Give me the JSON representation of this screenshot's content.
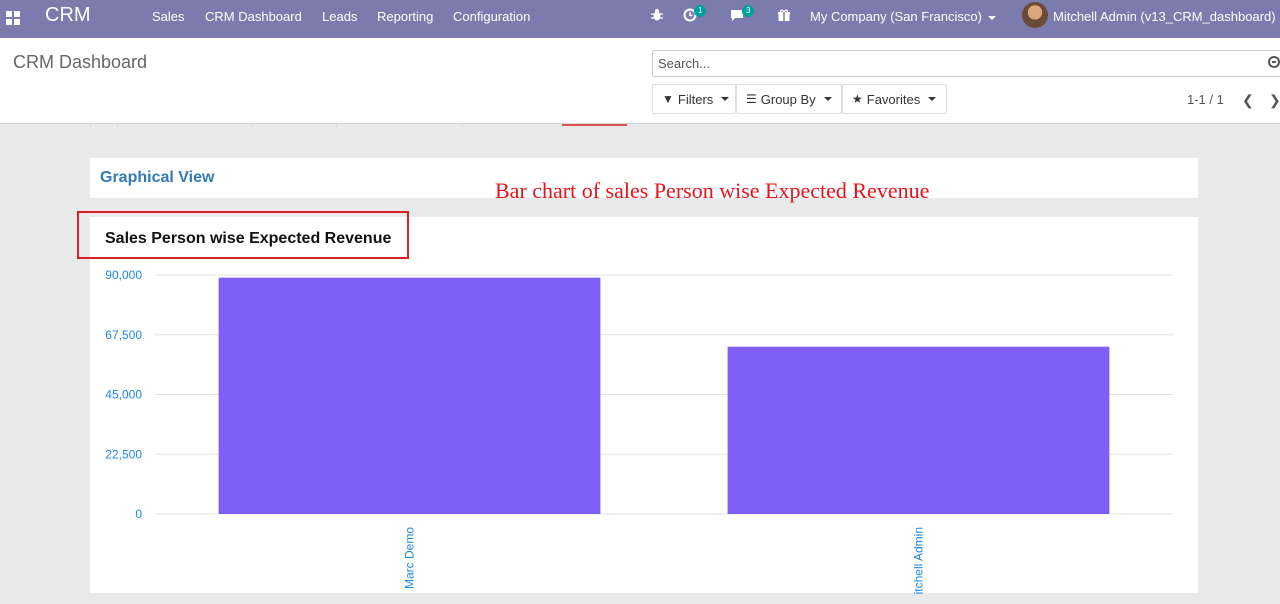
{
  "navbar": {
    "brand": "CRM",
    "menu": [
      "Sales",
      "CRM Dashboard",
      "Leads",
      "Reporting",
      "Configuration"
    ],
    "activity_count": "1",
    "message_count": "3",
    "company": "My Company (San Francisco)",
    "user": "Mitchell Admin (v13_CRM_dashboard)"
  },
  "control_panel": {
    "title": "CRM Dashboard",
    "search_placeholder": "Search...",
    "filters_label": "Filters",
    "group_by_label": "Group By",
    "favorites_label": "Favorites",
    "pager": "1-1 / 1"
  },
  "dashboard": {
    "graphical_view_title": "Graphical View",
    "annotation": "Bar chart of sales Person wise Expected Revenue"
  },
  "colors": {
    "navbar": "#7c7bad",
    "bar": "#7f5ff6",
    "axis_labels": "#1e88e5",
    "annotation": "#e8131b"
  },
  "chart_data": {
    "type": "bar",
    "title": "Sales Person wise Expected Revenue",
    "categories": [
      "Marc Demo",
      "Mitchell Admin"
    ],
    "visible_category_text": [
      "Marc Demo",
      "itchell Admin"
    ],
    "values": [
      89000,
      63000
    ],
    "ylim": [
      0,
      90000
    ],
    "yticks": [
      0,
      22500,
      45000,
      67500,
      90000
    ],
    "ytick_labels": [
      "0",
      "22,500",
      "45,000",
      "67,500",
      "90,000"
    ],
    "grid": true,
    "xlabel": "",
    "ylabel": ""
  }
}
